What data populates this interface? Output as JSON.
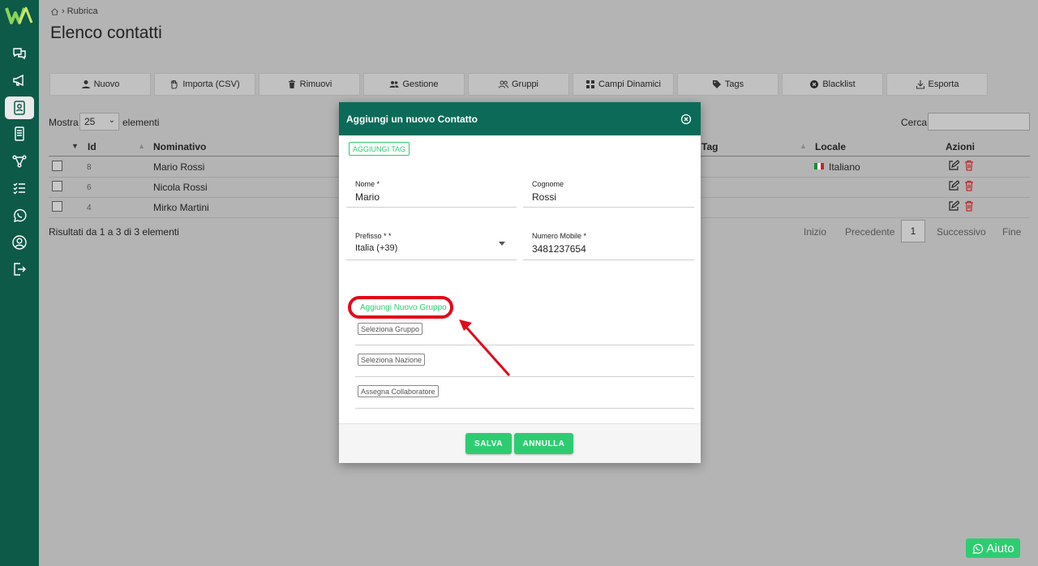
{
  "breadcrumb": {
    "item": "Rubrica"
  },
  "page_title": "Elenco contatti",
  "sidebar": {
    "items": [
      "chat-icon",
      "megaphone-icon",
      "contacts-icon",
      "document-icon",
      "flow-icon",
      "checklist-icon",
      "whatsapp-icon",
      "account-icon",
      "logout-icon"
    ],
    "active": "contacts-icon"
  },
  "toolbar": {
    "buttons": [
      {
        "label": "Nuovo",
        "icon": "user-plus-icon"
      },
      {
        "label": "Importa (CSV)",
        "icon": "hand-icon"
      },
      {
        "label": "Rimuovi",
        "icon": "trash-icon"
      },
      {
        "label": "Gestione",
        "icon": "users-icon"
      },
      {
        "label": "Gruppi",
        "icon": "users-outline-icon"
      },
      {
        "label": "Campi Dinamici",
        "icon": "grid-icon"
      },
      {
        "label": "Tags",
        "icon": "tag-icon"
      },
      {
        "label": "Blacklist",
        "icon": "ban-icon"
      },
      {
        "label": "Esporta",
        "icon": "download-icon"
      }
    ]
  },
  "table_controls": {
    "show_label": "Mostra",
    "show_value": "25",
    "show_after": "elementi",
    "search_label": "Cerca:"
  },
  "table": {
    "headers": {
      "id": "Id",
      "name": "Nominativo",
      "tag": "Tag",
      "locale": "Locale",
      "actions": "Azioni"
    },
    "rows": [
      {
        "id": "8",
        "name": "Mario Rossi",
        "locale": "Italiano"
      },
      {
        "id": "6",
        "name": "Nicola Rossi",
        "locale": ""
      },
      {
        "id": "4",
        "name": "Mirko Martini",
        "locale": ""
      }
    ]
  },
  "results_text": "Risultati da 1 a 3 di 3 elementi",
  "pagination": {
    "first": "Inizio",
    "prev": "Precedente",
    "current": "1",
    "next": "Successivo",
    "last": "Fine"
  },
  "modal": {
    "title": "Aggiungi un nuovo Contatto",
    "add_tag": "AGGIUNGI TAG",
    "nome_label": "Nome *",
    "nome_value": "Mario",
    "cognome_label": "Cognome",
    "cognome_value": "Rossi",
    "prefisso_label": "Prefisso * *",
    "prefisso_value": "Italia (+39)",
    "mobile_label": "Numero Mobile *",
    "mobile_value": "3481237654",
    "add_group": "Aggiungi Nuovo Gruppo",
    "select_group": "Seleziona Gruppo",
    "select_nation": "Seleziona Nazione",
    "assign_collaborator": "Assegna Collaboratore",
    "save": "SALVA",
    "cancel": "ANNULLA"
  },
  "help_button": "Aiuto",
  "colors": {
    "sidebar": "#0e5a49",
    "modal_header": "#0b6b58",
    "accent": "#2ecc71",
    "highlight": "#e3071a"
  }
}
